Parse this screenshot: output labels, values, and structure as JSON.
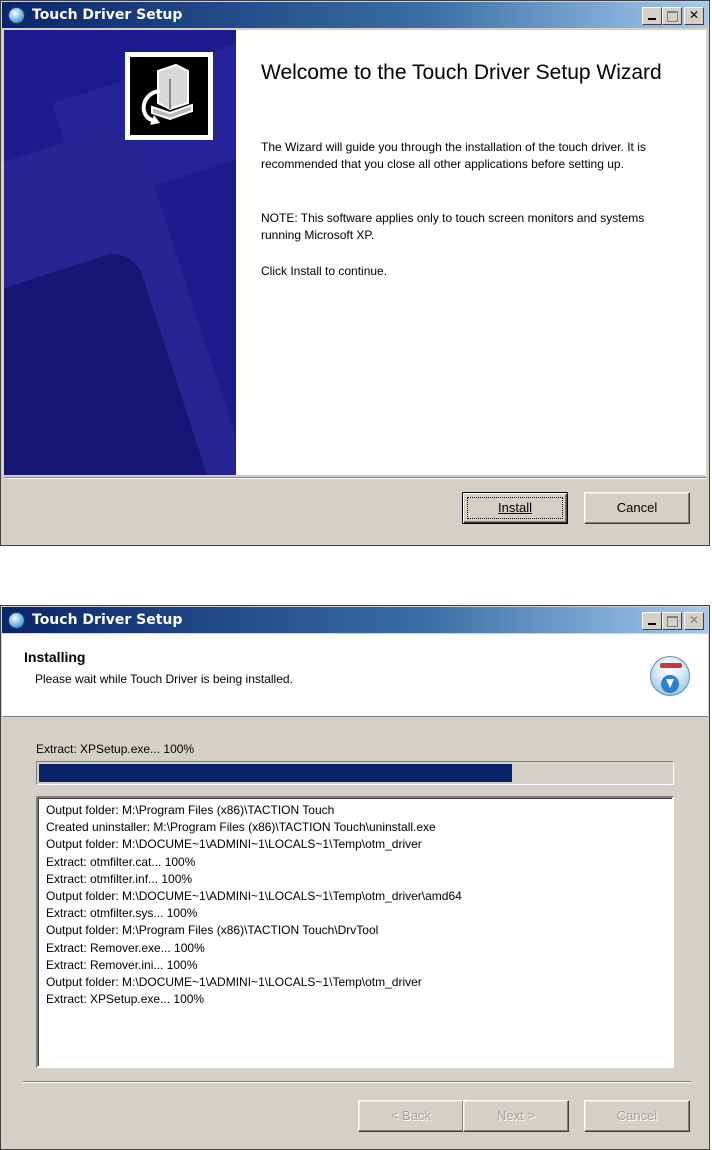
{
  "window1": {
    "title": "Touch Driver Setup",
    "heading": "Welcome to the Touch Driver Setup Wizard",
    "paragraph1": "The Wizard will guide you through the installation of the touch driver. It is recommended that you close all other applications before setting up.",
    "paragraph2": "NOTE: This software applies only to touch screen monitors and systems running Microsoft XP.",
    "paragraph3": "Click Install to continue.",
    "install_label": "Install",
    "cancel_label": "Cancel"
  },
  "window2": {
    "title": "Touch Driver Setup",
    "header_title": "Installing",
    "header_subtitle": "Please wait while Touch Driver is being installed.",
    "status": "Extract: XPSetup.exe... 100%",
    "progress_fraction": 0.75,
    "log": [
      "Output folder: M:\\Program Files (x86)\\TACTION Touch",
      "Created uninstaller: M:\\Program Files (x86)\\TACTION Touch\\uninstall.exe",
      "Output folder: M:\\DOCUME~1\\ADMINI~1\\LOCALS~1\\Temp\\otm_driver",
      "Extract: otmfilter.cat... 100%",
      "Extract: otmfilter.inf... 100%",
      "Output folder: M:\\DOCUME~1\\ADMINI~1\\LOCALS~1\\Temp\\otm_driver\\amd64",
      "Extract: otmfilter.sys... 100%",
      "Output folder: M:\\Program Files (x86)\\TACTION Touch\\DrvTool",
      "Extract: Remover.exe... 100%",
      "Extract: Remover.ini... 100%",
      "Output folder: M:\\DOCUME~1\\ADMINI~1\\LOCALS~1\\Temp\\otm_driver",
      "Extract: XPSetup.exe... 100%"
    ],
    "back_label": "< Back",
    "next_label": "Next >",
    "cancel_label": "Cancel"
  }
}
